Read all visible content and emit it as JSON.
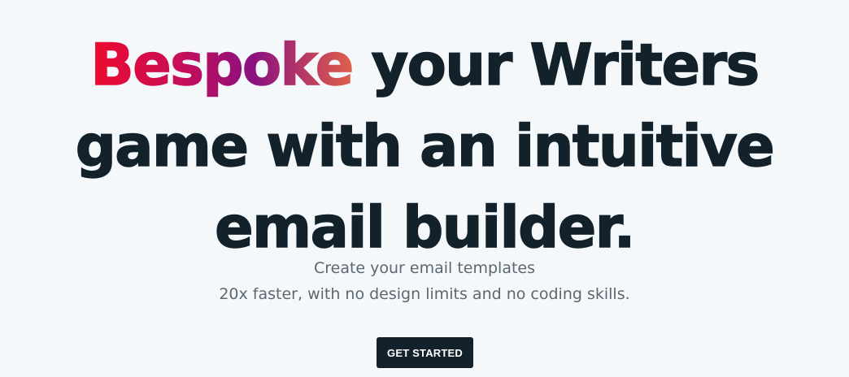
{
  "hero": {
    "headline": {
      "highlight_word": "Bespoke",
      "line1_rest": " your Writers",
      "line2": "game with an intuitive",
      "line3": "email builder."
    },
    "subtitle_line1": "Create your email templates",
    "subtitle_line2": "20x faster, with no design limits and no coding skills.",
    "cta_label": "GET STARTED"
  },
  "colors": {
    "background": "#f4f8fb",
    "headline_text": "#13212b",
    "gradient_start": "#ec0b2d",
    "gradient_mid": "#8a1180",
    "gradient_end": "#e0604a",
    "subtitle_text": "#5c6770",
    "button_bg": "#13212b",
    "button_text": "#ffffff"
  }
}
